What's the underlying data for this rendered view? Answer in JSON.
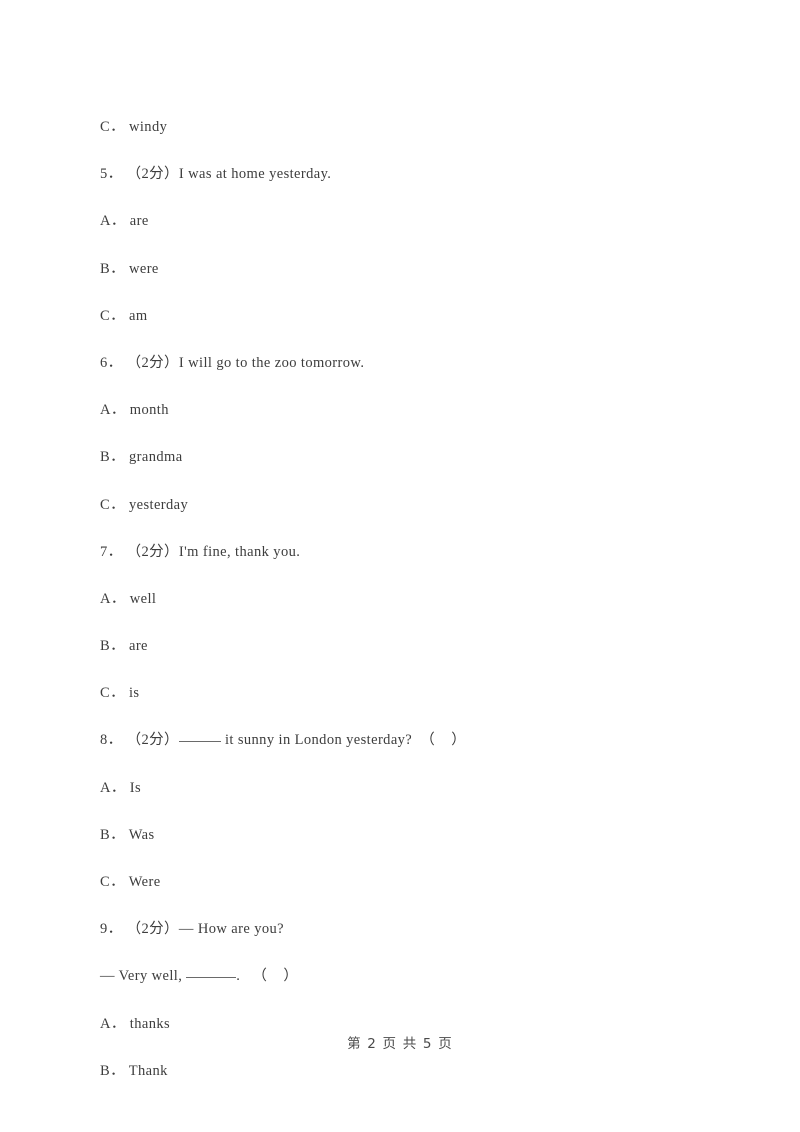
{
  "document": {
    "footer": "第 2 页 共 5 页",
    "lines": [
      {
        "kind": "option",
        "text": "C． windy"
      },
      {
        "kind": "question",
        "text": "5． （2分）I was at home yesterday."
      },
      {
        "kind": "option",
        "text": "A． are"
      },
      {
        "kind": "option",
        "text": "B． were"
      },
      {
        "kind": "option",
        "text": "C． am"
      },
      {
        "kind": "question",
        "text": "6． （2分）I will go to the zoo tomorrow."
      },
      {
        "kind": "option",
        "text": "A． month"
      },
      {
        "kind": "option",
        "text": "B． grandma"
      },
      {
        "kind": "option",
        "text": "C． yesterday"
      },
      {
        "kind": "question",
        "text": "7． （2分）I'm fine, thank you."
      },
      {
        "kind": "option",
        "text": "A． well"
      },
      {
        "kind": "option",
        "text": "B． are"
      },
      {
        "kind": "option",
        "text": "C． is"
      },
      {
        "kind": "question",
        "text": "8． （2分）",
        "blank": "blank-8",
        "text2": " it sunny in London yesterday?  （    ）"
      },
      {
        "kind": "option",
        "text": "A． Is"
      },
      {
        "kind": "option",
        "text": "B． Was"
      },
      {
        "kind": "option",
        "text": "C． Were"
      },
      {
        "kind": "question",
        "text": "9． （2分）— How are you?"
      },
      {
        "kind": "question",
        "text": "— Very well, ",
        "blank": "blank-9",
        "text2": ".   （    ）"
      },
      {
        "kind": "option",
        "text": "A． thanks"
      },
      {
        "kind": "option",
        "text": "B． Thank"
      }
    ]
  }
}
